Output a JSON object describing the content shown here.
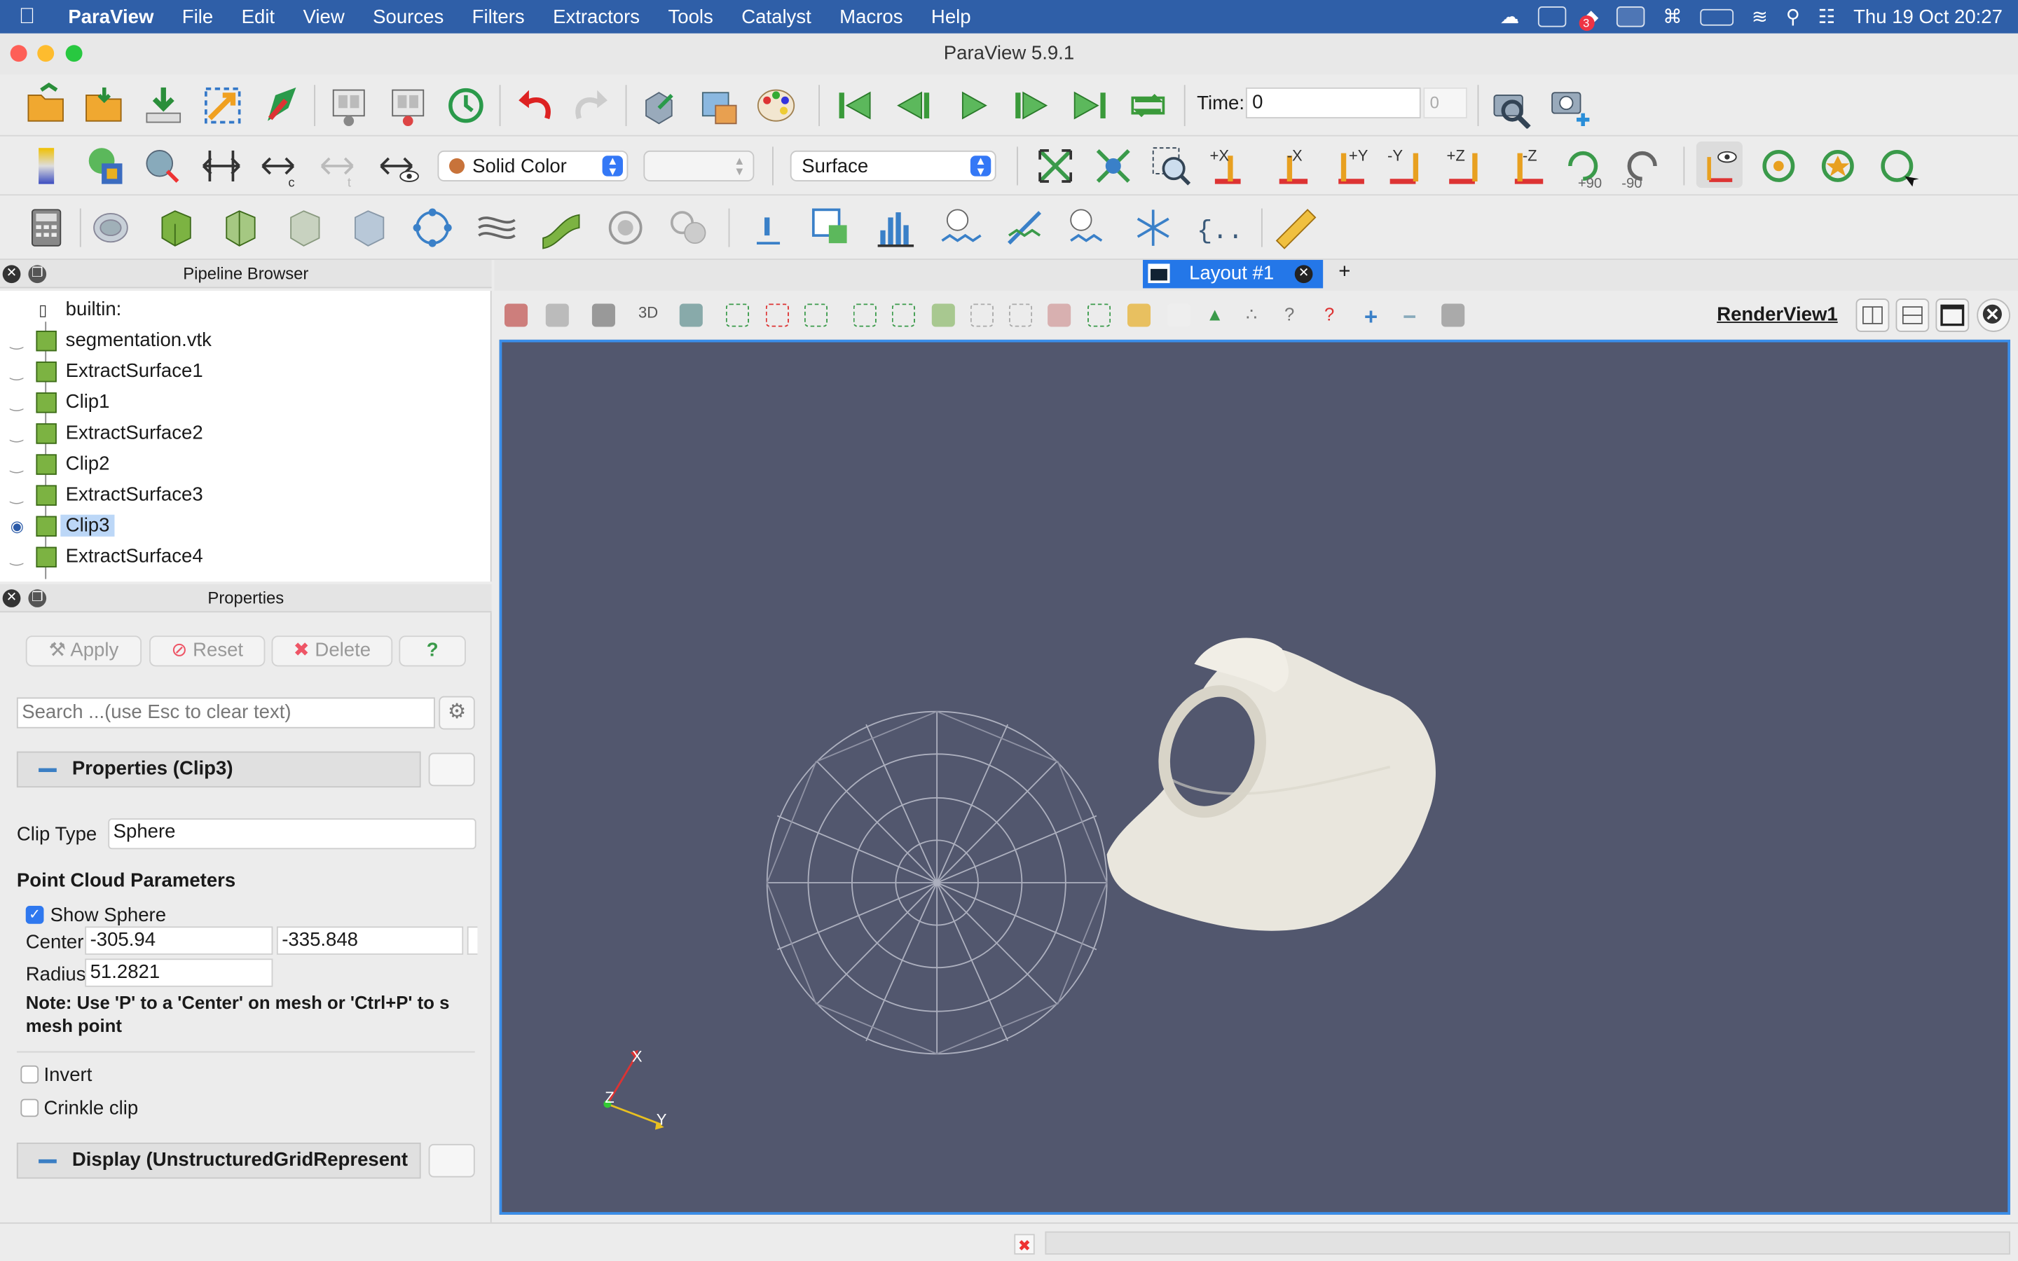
{
  "menubar": {
    "app": "ParaView",
    "items": [
      "File",
      "Edit",
      "View",
      "Sources",
      "Filters",
      "Extractors",
      "Tools",
      "Catalyst",
      "Macros",
      "Help"
    ],
    "clock": "Thu 19 Oct  20:27",
    "badge": "3"
  },
  "window": {
    "title": "ParaView 5.9.1"
  },
  "toolbar": {
    "time_label": "Time:",
    "time_value": "0",
    "time_index": "0",
    "color_combo": "Solid Color",
    "repr_combo": "Surface",
    "camera_labels": [
      "+X",
      "-X",
      "+Y",
      "-Y",
      "+Z",
      "-Z",
      "+90",
      "-90"
    ]
  },
  "pipeline": {
    "title": "Pipeline Browser",
    "items": [
      {
        "label": "builtin:",
        "visible": false
      },
      {
        "label": "segmentation.vtk",
        "visible": false
      },
      {
        "label": "ExtractSurface1",
        "visible": false
      },
      {
        "label": "Clip1",
        "visible": false
      },
      {
        "label": "ExtractSurface2",
        "visible": false
      },
      {
        "label": "Clip2",
        "visible": false
      },
      {
        "label": "ExtractSurface3",
        "visible": false
      },
      {
        "label": "Clip3",
        "visible": true,
        "selected": true
      },
      {
        "label": "ExtractSurface4",
        "visible": false
      }
    ]
  },
  "properties": {
    "title": "Properties",
    "apply": "Apply",
    "reset": "Reset",
    "delete": "Delete",
    "help": "?",
    "search_placeholder": "Search ...(use Esc to clear text)",
    "section_props": "Properties (Clip3)",
    "clip_type_label": "Clip Type",
    "clip_type_value": "Sphere",
    "point_cloud": "Point Cloud Parameters",
    "show_sphere": "Show Sphere",
    "center_label": "Center",
    "center_x": "-305.94",
    "center_y": "-335.848",
    "radius_label": "Radius",
    "radius_value": "51.2821",
    "note_line1": "Note: Use 'P' to a 'Center' on mesh or 'Ctrl+P' to s",
    "note_line2": "mesh point",
    "invert": "Invert",
    "crinkle": "Crinkle clip",
    "section_display": "Display (UnstructuredGridRepresent"
  },
  "layout": {
    "tab": "Layout #1",
    "plus": "+",
    "view_name": "RenderView1",
    "mode_3d": "3D"
  },
  "axes": {
    "x": "X",
    "y": "Y",
    "z": "Z"
  },
  "colors": {
    "menubar": "#2f5fa8",
    "render_bg": "#52576e",
    "accent": "#2477e8",
    "mesh": "#ebe8e0"
  }
}
